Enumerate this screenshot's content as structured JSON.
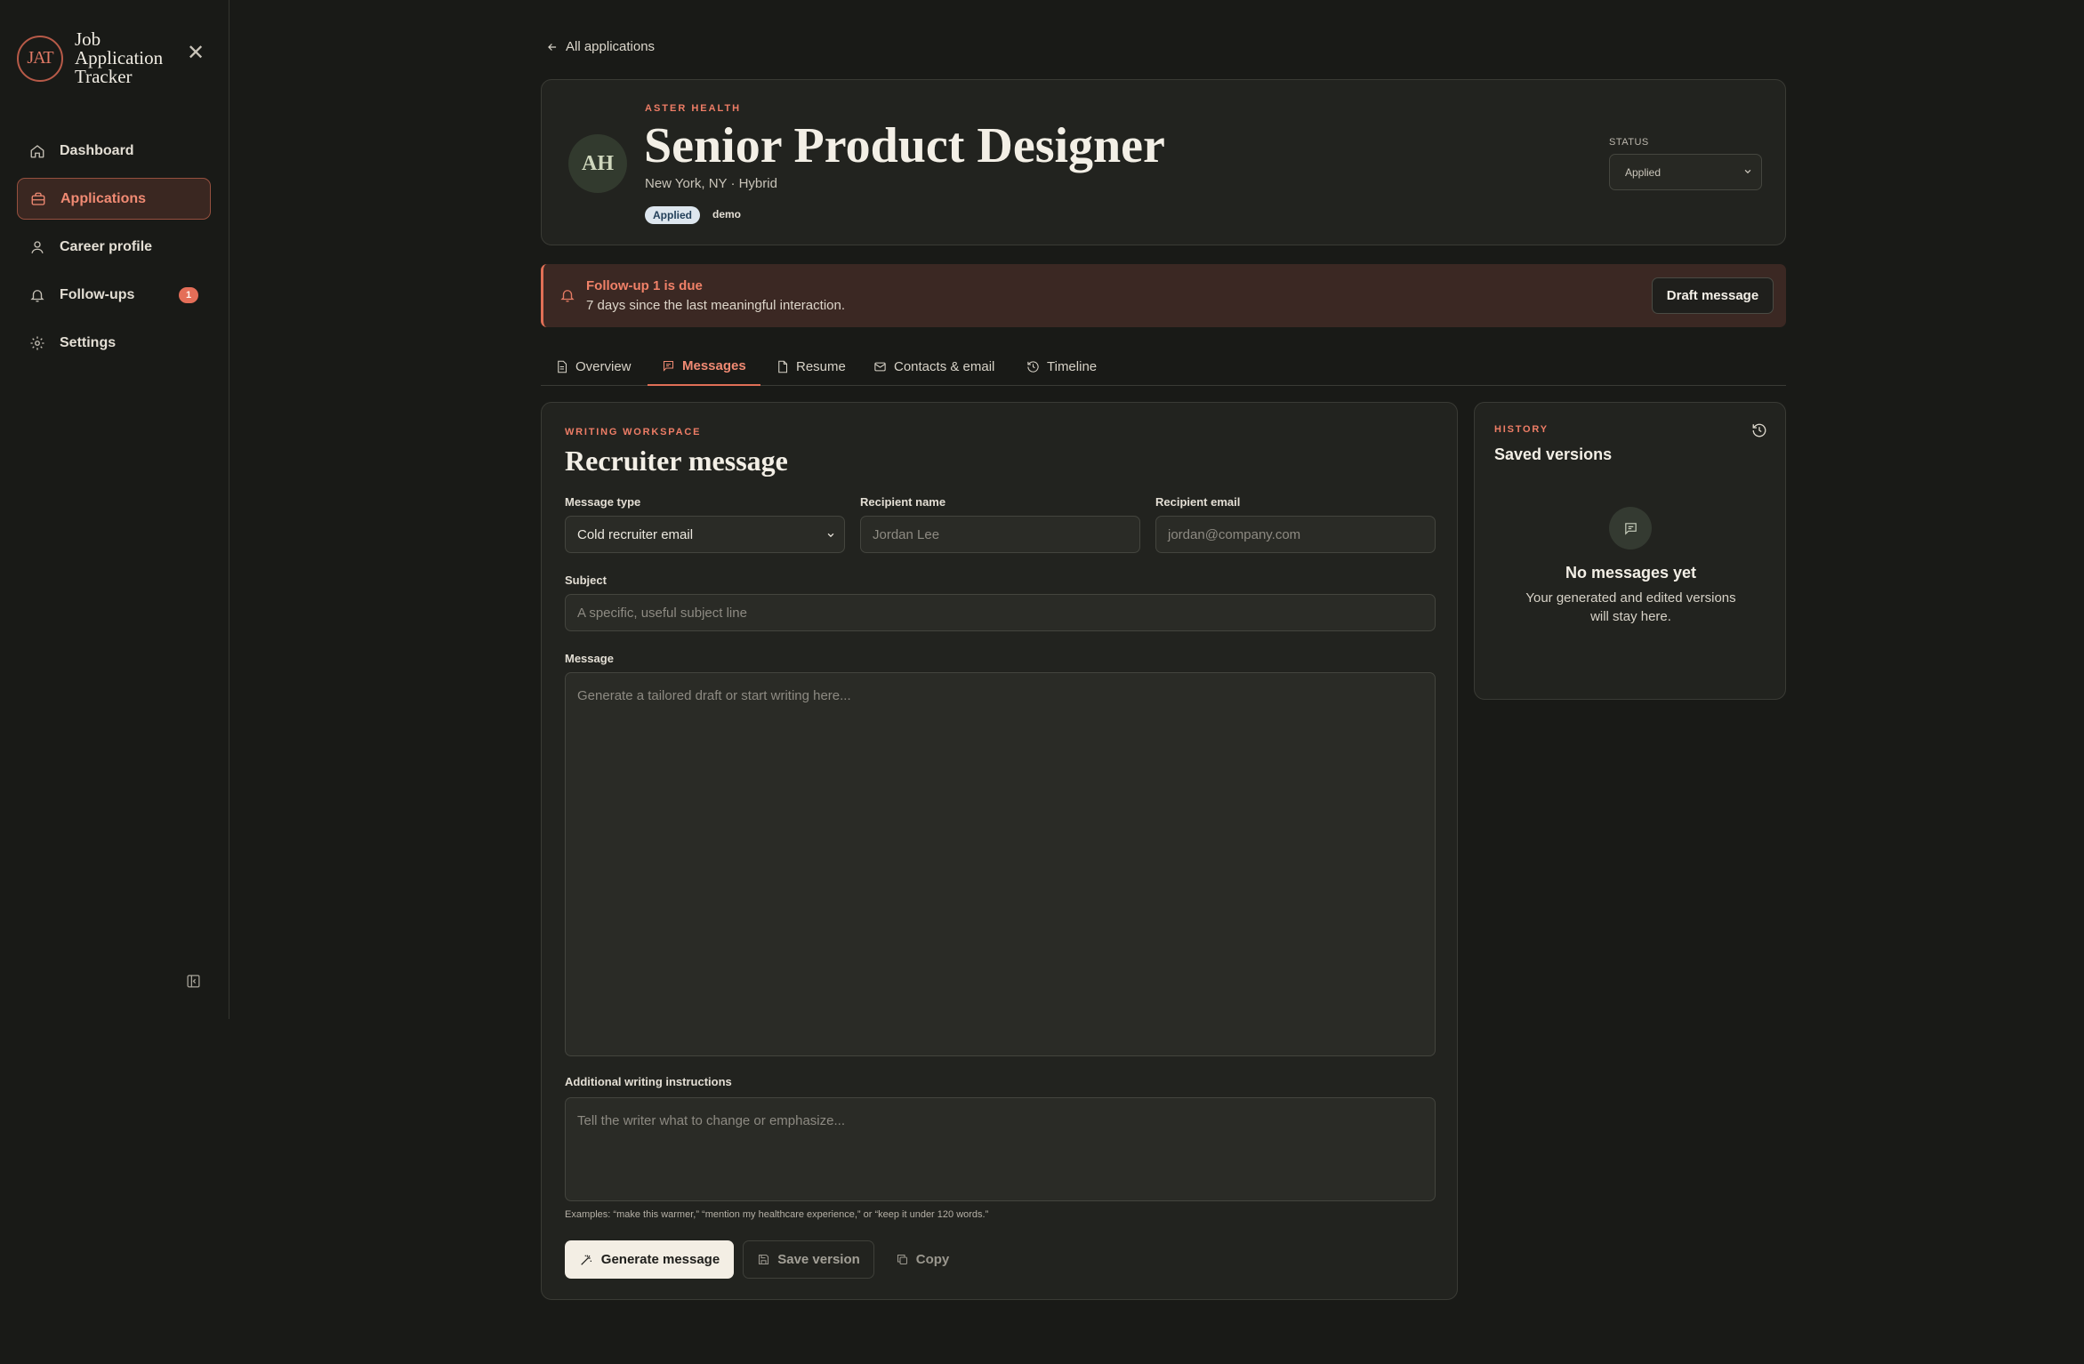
{
  "app": {
    "logo_text": "JAT",
    "name": "Job Application Tracker"
  },
  "sidebar": {
    "items": [
      {
        "label": "Dashboard",
        "icon": "home-icon"
      },
      {
        "label": "Applications",
        "icon": "briefcase-icon",
        "active": true
      },
      {
        "label": "Career profile",
        "icon": "user-icon"
      },
      {
        "label": "Follow-ups",
        "icon": "bell-icon",
        "badge": "1"
      },
      {
        "label": "Settings",
        "icon": "gear-icon"
      }
    ]
  },
  "back_link": "All applications",
  "job": {
    "company": "ASTER HEALTH",
    "initials": "AH",
    "title": "Senior Product Designer",
    "location": "New York, NY · Hybrid",
    "status_pill": "Applied",
    "tag": "demo",
    "status_label": "STATUS",
    "status_value": "Applied"
  },
  "alert": {
    "title": "Follow-up 1 is due",
    "text": "7 days since the last meaningful interaction.",
    "button": "Draft message"
  },
  "tabs": [
    {
      "label": "Overview",
      "icon": "document-icon"
    },
    {
      "label": "Messages",
      "icon": "message-icon",
      "active": true
    },
    {
      "label": "Resume",
      "icon": "file-icon"
    },
    {
      "label": "Contacts & email",
      "icon": "mail-icon"
    },
    {
      "label": "Timeline",
      "icon": "history-icon"
    }
  ],
  "workspace": {
    "kicker": "WRITING WORKSPACE",
    "title": "Recruiter message",
    "message_type_label": "Message type",
    "message_type_value": "Cold recruiter email",
    "recipient_name_label": "Recipient name",
    "recipient_name_placeholder": "Jordan Lee",
    "recipient_email_label": "Recipient email",
    "recipient_email_placeholder": "jordan@company.com",
    "subject_label": "Subject",
    "subject_placeholder": "A specific, useful subject line",
    "message_label": "Message",
    "message_placeholder": "Generate a tailored draft or start writing here...",
    "instructions_label": "Additional writing instructions",
    "instructions_placeholder": "Tell the writer what to change or emphasize...",
    "hint": "Examples: “make this warmer,” “mention my healthcare experience,” or “keep it under 120 words.”",
    "generate_button": "Generate message",
    "save_button": "Save version",
    "copy_button": "Copy"
  },
  "history": {
    "kicker": "HISTORY",
    "title": "Saved versions",
    "empty_title": "No messages yet",
    "empty_text": "Your generated and edited versions will stay here."
  },
  "colors": {
    "accent": "#e06f56",
    "background": "#191a17",
    "panel": "#22231f"
  }
}
